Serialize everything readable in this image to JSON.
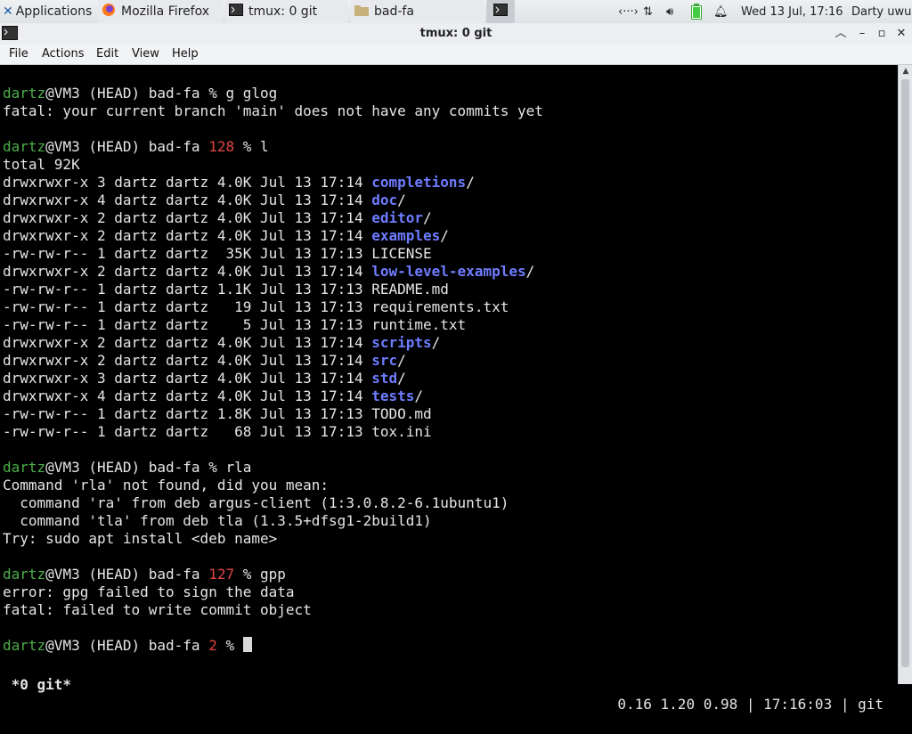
{
  "panel": {
    "applications_label": "Applications",
    "tasks": [
      {
        "label": "Mozilla Firefox",
        "icon": "firefox-icon"
      },
      {
        "label": "tmux: 0 git",
        "icon": "terminal-icon"
      },
      {
        "label": "bad-fa",
        "icon": "folder-icon"
      }
    ],
    "clock": "Wed 13 Jul, 17:16",
    "user": "Darty uwu"
  },
  "window": {
    "title": "tmux: 0 git"
  },
  "menu": {
    "items": [
      "File",
      "Actions",
      "Edit",
      "View",
      "Help"
    ]
  },
  "terminal": {
    "prompt_user": "dartz",
    "prompt_host": "@VM3 (HEAD) bad-fa ",
    "commands": [
      {
        "status": "",
        "cmd": "g glog",
        "output": [
          "fatal: your current branch 'main' does not have any commits yet"
        ]
      },
      {
        "status": "128 ",
        "cmd": "l",
        "output_header": "total 92K"
      },
      {
        "status": "",
        "cmd": "rla",
        "output": [
          "Command 'rla' not found, did you mean:",
          "  command 'ra' from deb argus-client (1:3.0.8.2-6.1ubuntu1)",
          "  command 'tla' from deb tla (1.3.5+dfsg1-2build1)",
          "Try: sudo apt install <deb name>"
        ]
      },
      {
        "status": "127 ",
        "cmd": "gpp",
        "output": [
          "error: gpg failed to sign the data",
          "fatal: failed to write commit object"
        ]
      },
      {
        "status": "2 ",
        "cmd": ""
      }
    ],
    "listing": [
      {
        "meta": "drwxrwxr-x 3 dartz dartz 4.0K Jul 13 17:14 ",
        "name": "completions",
        "dir": true
      },
      {
        "meta": "drwxrwxr-x 4 dartz dartz 4.0K Jul 13 17:14 ",
        "name": "doc",
        "dir": true
      },
      {
        "meta": "drwxrwxr-x 2 dartz dartz 4.0K Jul 13 17:14 ",
        "name": "editor",
        "dir": true
      },
      {
        "meta": "drwxrwxr-x 2 dartz dartz 4.0K Jul 13 17:14 ",
        "name": "examples",
        "dir": true
      },
      {
        "meta": "-rw-rw-r-- 1 dartz dartz  35K Jul 13 17:13 ",
        "name": "LICENSE",
        "dir": false
      },
      {
        "meta": "drwxrwxr-x 2 dartz dartz 4.0K Jul 13 17:14 ",
        "name": "low-level-examples",
        "dir": true
      },
      {
        "meta": "-rw-rw-r-- 1 dartz dartz 1.1K Jul 13 17:13 ",
        "name": "README.md",
        "dir": false
      },
      {
        "meta": "-rw-rw-r-- 1 dartz dartz   19 Jul 13 17:13 ",
        "name": "requirements.txt",
        "dir": false
      },
      {
        "meta": "-rw-rw-r-- 1 dartz dartz    5 Jul 13 17:13 ",
        "name": "runtime.txt",
        "dir": false
      },
      {
        "meta": "drwxrwxr-x 2 dartz dartz 4.0K Jul 13 17:14 ",
        "name": "scripts",
        "dir": true
      },
      {
        "meta": "drwxrwxr-x 2 dartz dartz 4.0K Jul 13 17:14 ",
        "name": "src",
        "dir": true
      },
      {
        "meta": "drwxrwxr-x 3 dartz dartz 4.0K Jul 13 17:14 ",
        "name": "std",
        "dir": true
      },
      {
        "meta": "drwxrwxr-x 4 dartz dartz 4.0K Jul 13 17:14 ",
        "name": "tests",
        "dir": true
      },
      {
        "meta": "-rw-rw-r-- 1 dartz dartz 1.8K Jul 13 17:13 ",
        "name": "TODO.md",
        "dir": false
      },
      {
        "meta": "-rw-rw-r-- 1 dartz dartz   68 Jul 13 17:13 ",
        "name": "tox.ini",
        "dir": false
      }
    ]
  },
  "tmux_status": {
    "left": " *0 git*",
    "right": "0.16 1.20 0.98 | 17:16:03 | git"
  },
  "colors": {
    "prompt_user": "#4cae48",
    "exit_status": "#e04545",
    "directory": "#6e7cff"
  }
}
